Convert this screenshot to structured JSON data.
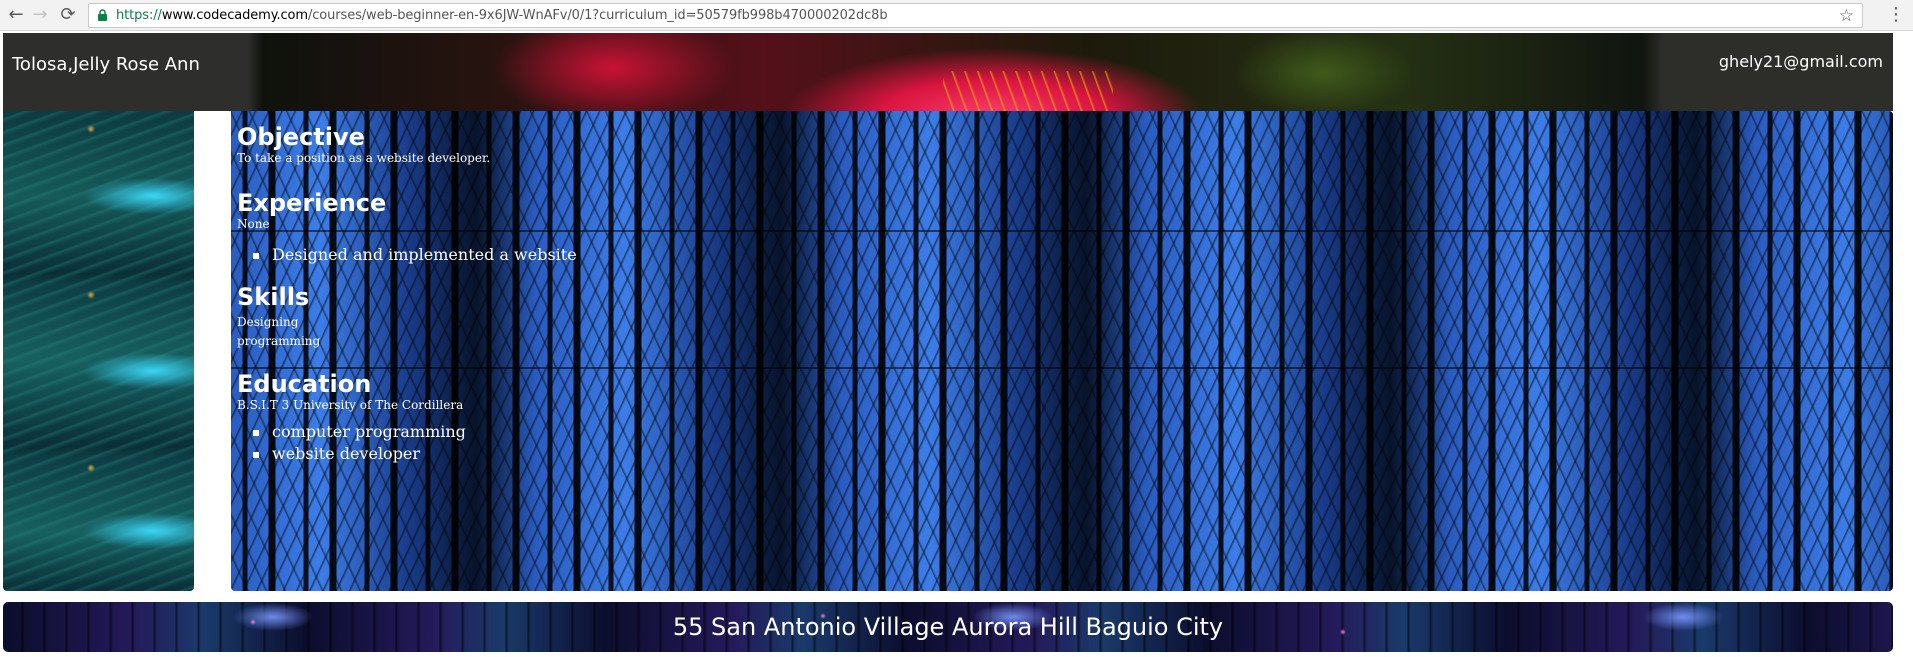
{
  "browser": {
    "back_icon": "←",
    "forward_icon": "→",
    "reload_icon": "⟳",
    "url_scheme": "https://",
    "url_domain": "www.codecademy.com",
    "url_path": "/courses/web-beginner-en-9x6JW-WnAFv/0/1?curriculum_id=50579fb998b470000202dc8b",
    "star_icon": "☆",
    "menu_icon": "⋮"
  },
  "header": {
    "name": "Tolosa,Jelly Rose Ann",
    "email": "ghely21@gmail.com"
  },
  "main": {
    "objective": {
      "heading": "Objective",
      "text": "To take a position as a website developer."
    },
    "experience": {
      "heading": "Experience",
      "text": "None",
      "items": [
        "Designed and implemented a website"
      ]
    },
    "skills": {
      "heading": "Skills",
      "lines": [
        "Designing",
        "programming"
      ]
    },
    "education": {
      "heading": "Education",
      "text": "B.S.I.T 3 University of The Cordillera",
      "items": [
        "computer programming",
        "website developer"
      ]
    }
  },
  "footer": {
    "address": "55 San Antonio Village Aurora Hill Baguio City"
  },
  "colors": {
    "url_scheme": "#0b8043",
    "text_on_image": "#ffffff"
  }
}
